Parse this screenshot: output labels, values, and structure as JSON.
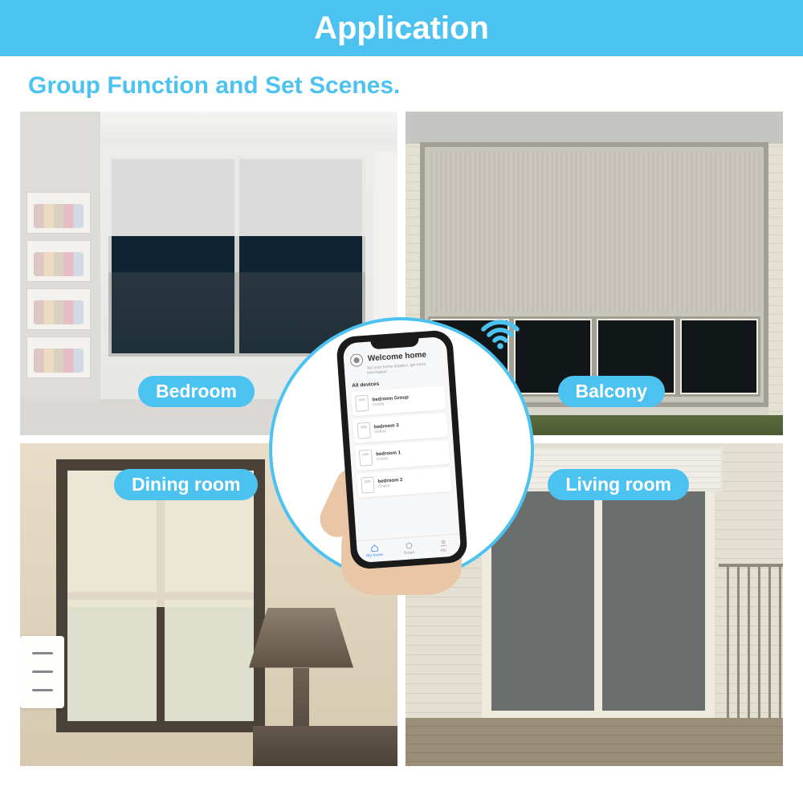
{
  "header": {
    "title": "Application"
  },
  "subtitle": "Group Function and Set Scenes.",
  "rooms": {
    "bedroom": "Bedroom",
    "balcony": "Balcony",
    "dining": "Dining room",
    "living": "Living room"
  },
  "phone": {
    "welcome_title": "Welcome home",
    "welcome_sub": "Set your home location, get more information",
    "section": "All devices",
    "devices": [
      {
        "name": "bedroom Group",
        "status": "Online"
      },
      {
        "name": "bedroom 3",
        "status": "Online"
      },
      {
        "name": "bedroom 1",
        "status": "Online"
      },
      {
        "name": "bedroom 2",
        "status": "Online"
      }
    ],
    "nav": {
      "home": "My home",
      "smart": "Smart",
      "me": "Me"
    }
  }
}
